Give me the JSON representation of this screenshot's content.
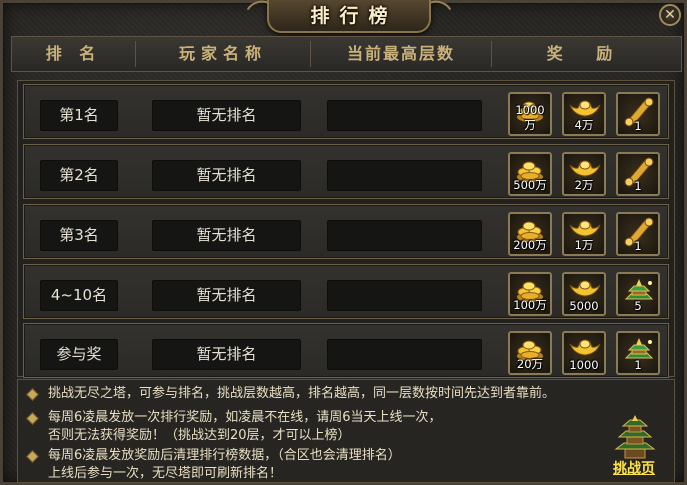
{
  "window": {
    "title": "排行榜",
    "close_glyph": "✕"
  },
  "header": {
    "rank": "排 名",
    "player": "玩家名称",
    "floor": "当前最高层数",
    "reward": "奖 励"
  },
  "rows": [
    {
      "rank": "第1名",
      "player": "暂无排名",
      "floor": "",
      "rewards": [
        {
          "icon": "gold-coins-icon",
          "count": "1000万"
        },
        {
          "icon": "gold-ingot-icon",
          "count": "4万"
        },
        {
          "icon": "golden-scroll-icon",
          "count": "1"
        }
      ]
    },
    {
      "rank": "第2名",
      "player": "暂无排名",
      "floor": "",
      "rewards": [
        {
          "icon": "gold-coins-icon",
          "count": "500万"
        },
        {
          "icon": "gold-ingot-icon",
          "count": "2万"
        },
        {
          "icon": "golden-scroll-icon",
          "count": "1"
        }
      ]
    },
    {
      "rank": "第3名",
      "player": "暂无排名",
      "floor": "",
      "rewards": [
        {
          "icon": "gold-coins-icon",
          "count": "200万"
        },
        {
          "icon": "gold-ingot-icon",
          "count": "1万"
        },
        {
          "icon": "golden-scroll-icon",
          "count": "1"
        }
      ]
    },
    {
      "rank": "4~10名",
      "player": "暂无排名",
      "floor": "",
      "rewards": [
        {
          "icon": "gold-coins-icon",
          "count": "100万"
        },
        {
          "icon": "gold-ingot-icon",
          "count": "5000"
        },
        {
          "icon": "jade-treasure-icon",
          "count": "5"
        }
      ]
    },
    {
      "rank": "参与奖",
      "player": "暂无排名",
      "floor": "",
      "rewards": [
        {
          "icon": "gold-coins-icon",
          "count": "20万"
        },
        {
          "icon": "gold-ingot-icon",
          "count": "1000"
        },
        {
          "icon": "jade-treasure-icon",
          "count": "1"
        }
      ]
    }
  ],
  "notes": [
    "挑战无尽之塔，可参与排名，挑战层数越高，排名越高，同一层数按时间先达到者靠前。",
    "每周6凌晨发放一次排行奖励，如凌晨不在线，请周6当天上线一次，",
    "否则无法获得奖励！（挑战达到20层，才可以上榜）",
    "每周6凌晨发放奖励后清理排行榜数据，（合区也会清理排名）",
    "上线后参与一次，无尽塔即可刷新排名！"
  ],
  "challenge_link": "挑战页",
  "colors": {
    "gold_text": "#c9b27a",
    "link": "#ffe34a"
  }
}
